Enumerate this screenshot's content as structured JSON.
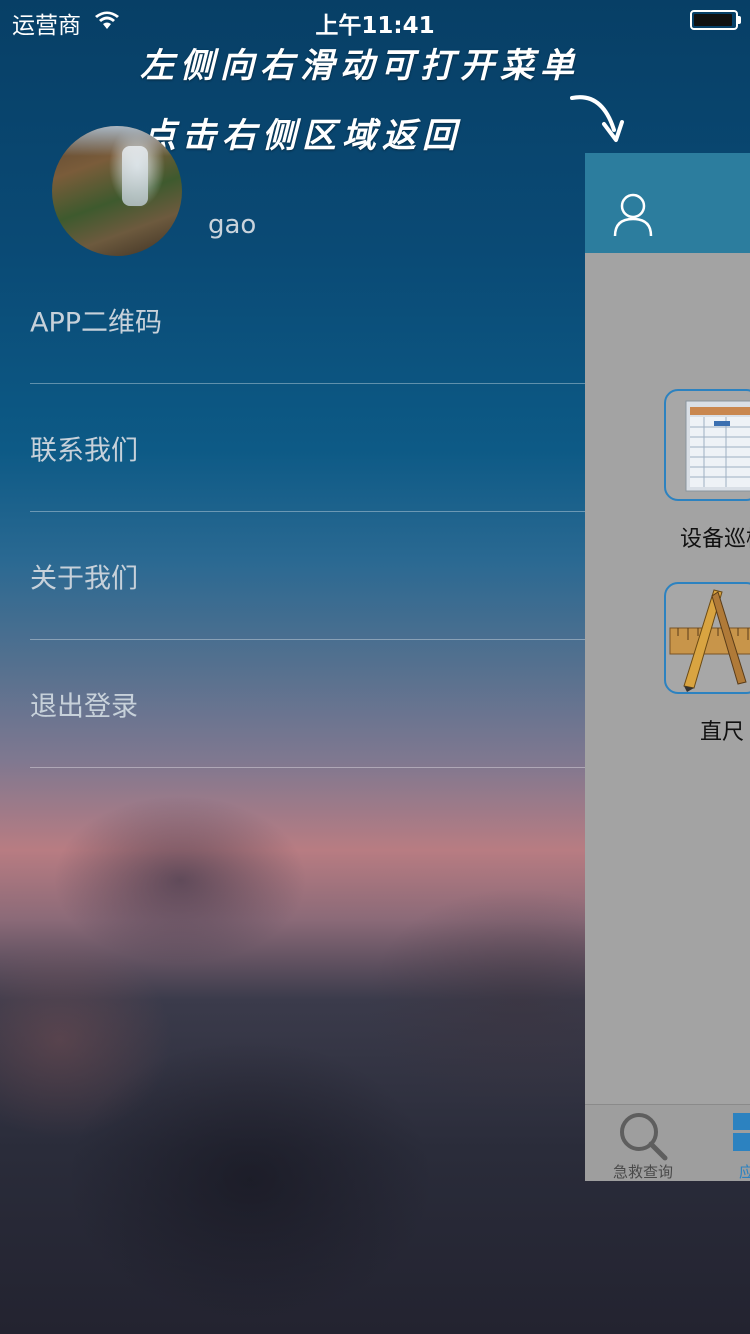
{
  "status_bar": {
    "carrier": "运营商",
    "time": "上午11:41",
    "battery_level": 0.95
  },
  "hint": {
    "line1": "左侧向右滑动可打开菜单",
    "line2": "点击右侧区域返回"
  },
  "profile": {
    "username": "gao"
  },
  "menu": {
    "items": [
      {
        "label": "APP二维码"
      },
      {
        "label": "联系我们"
      },
      {
        "label": "关于我们"
      },
      {
        "label": "退出登录"
      }
    ]
  },
  "main_panel": {
    "grid": [
      {
        "label": "设备巡检",
        "icon": "spreadsheet-icon"
      },
      {
        "label": "直尺",
        "icon": "ruler-pencil-icon"
      }
    ],
    "tabs": [
      {
        "label": "急救查询",
        "icon": "search-icon"
      },
      {
        "label": "应用",
        "icon": "grid-icon",
        "active": true
      }
    ]
  },
  "colors": {
    "header_bar": "#2c7d9e",
    "accent": "#2c82c0",
    "panel_dim": "#a3a3a3"
  }
}
